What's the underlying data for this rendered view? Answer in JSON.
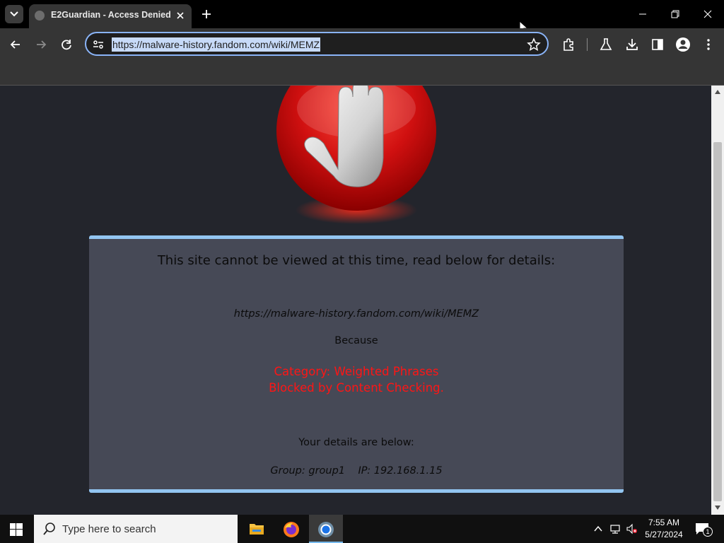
{
  "browser": {
    "tab_title": "E2Guardian - Access Denied",
    "url": "https://malware-history.fandom.com/wiki/MEMZ"
  },
  "page": {
    "headline": "This site cannot be viewed at this time, read below for details:",
    "blocked_url": "https://malware-history.fandom.com/wiki/MEMZ",
    "because_label": "Because",
    "reason_line1": "Category: Weighted Phrases",
    "reason_line2": "Blocked by Content Checking.",
    "details_heading": "Your details are below:",
    "details": "Group: group1    IP: 192.168.1.15"
  },
  "taskbar": {
    "search_placeholder": "Type here to search",
    "time": "7:55 AM",
    "date": "5/27/2024",
    "notification_count": "1"
  },
  "colors": {
    "accent_border": "#92c5f1",
    "panel_bg": "#464956",
    "reason_red": "#ff1515",
    "page_bg": "#23252c"
  }
}
